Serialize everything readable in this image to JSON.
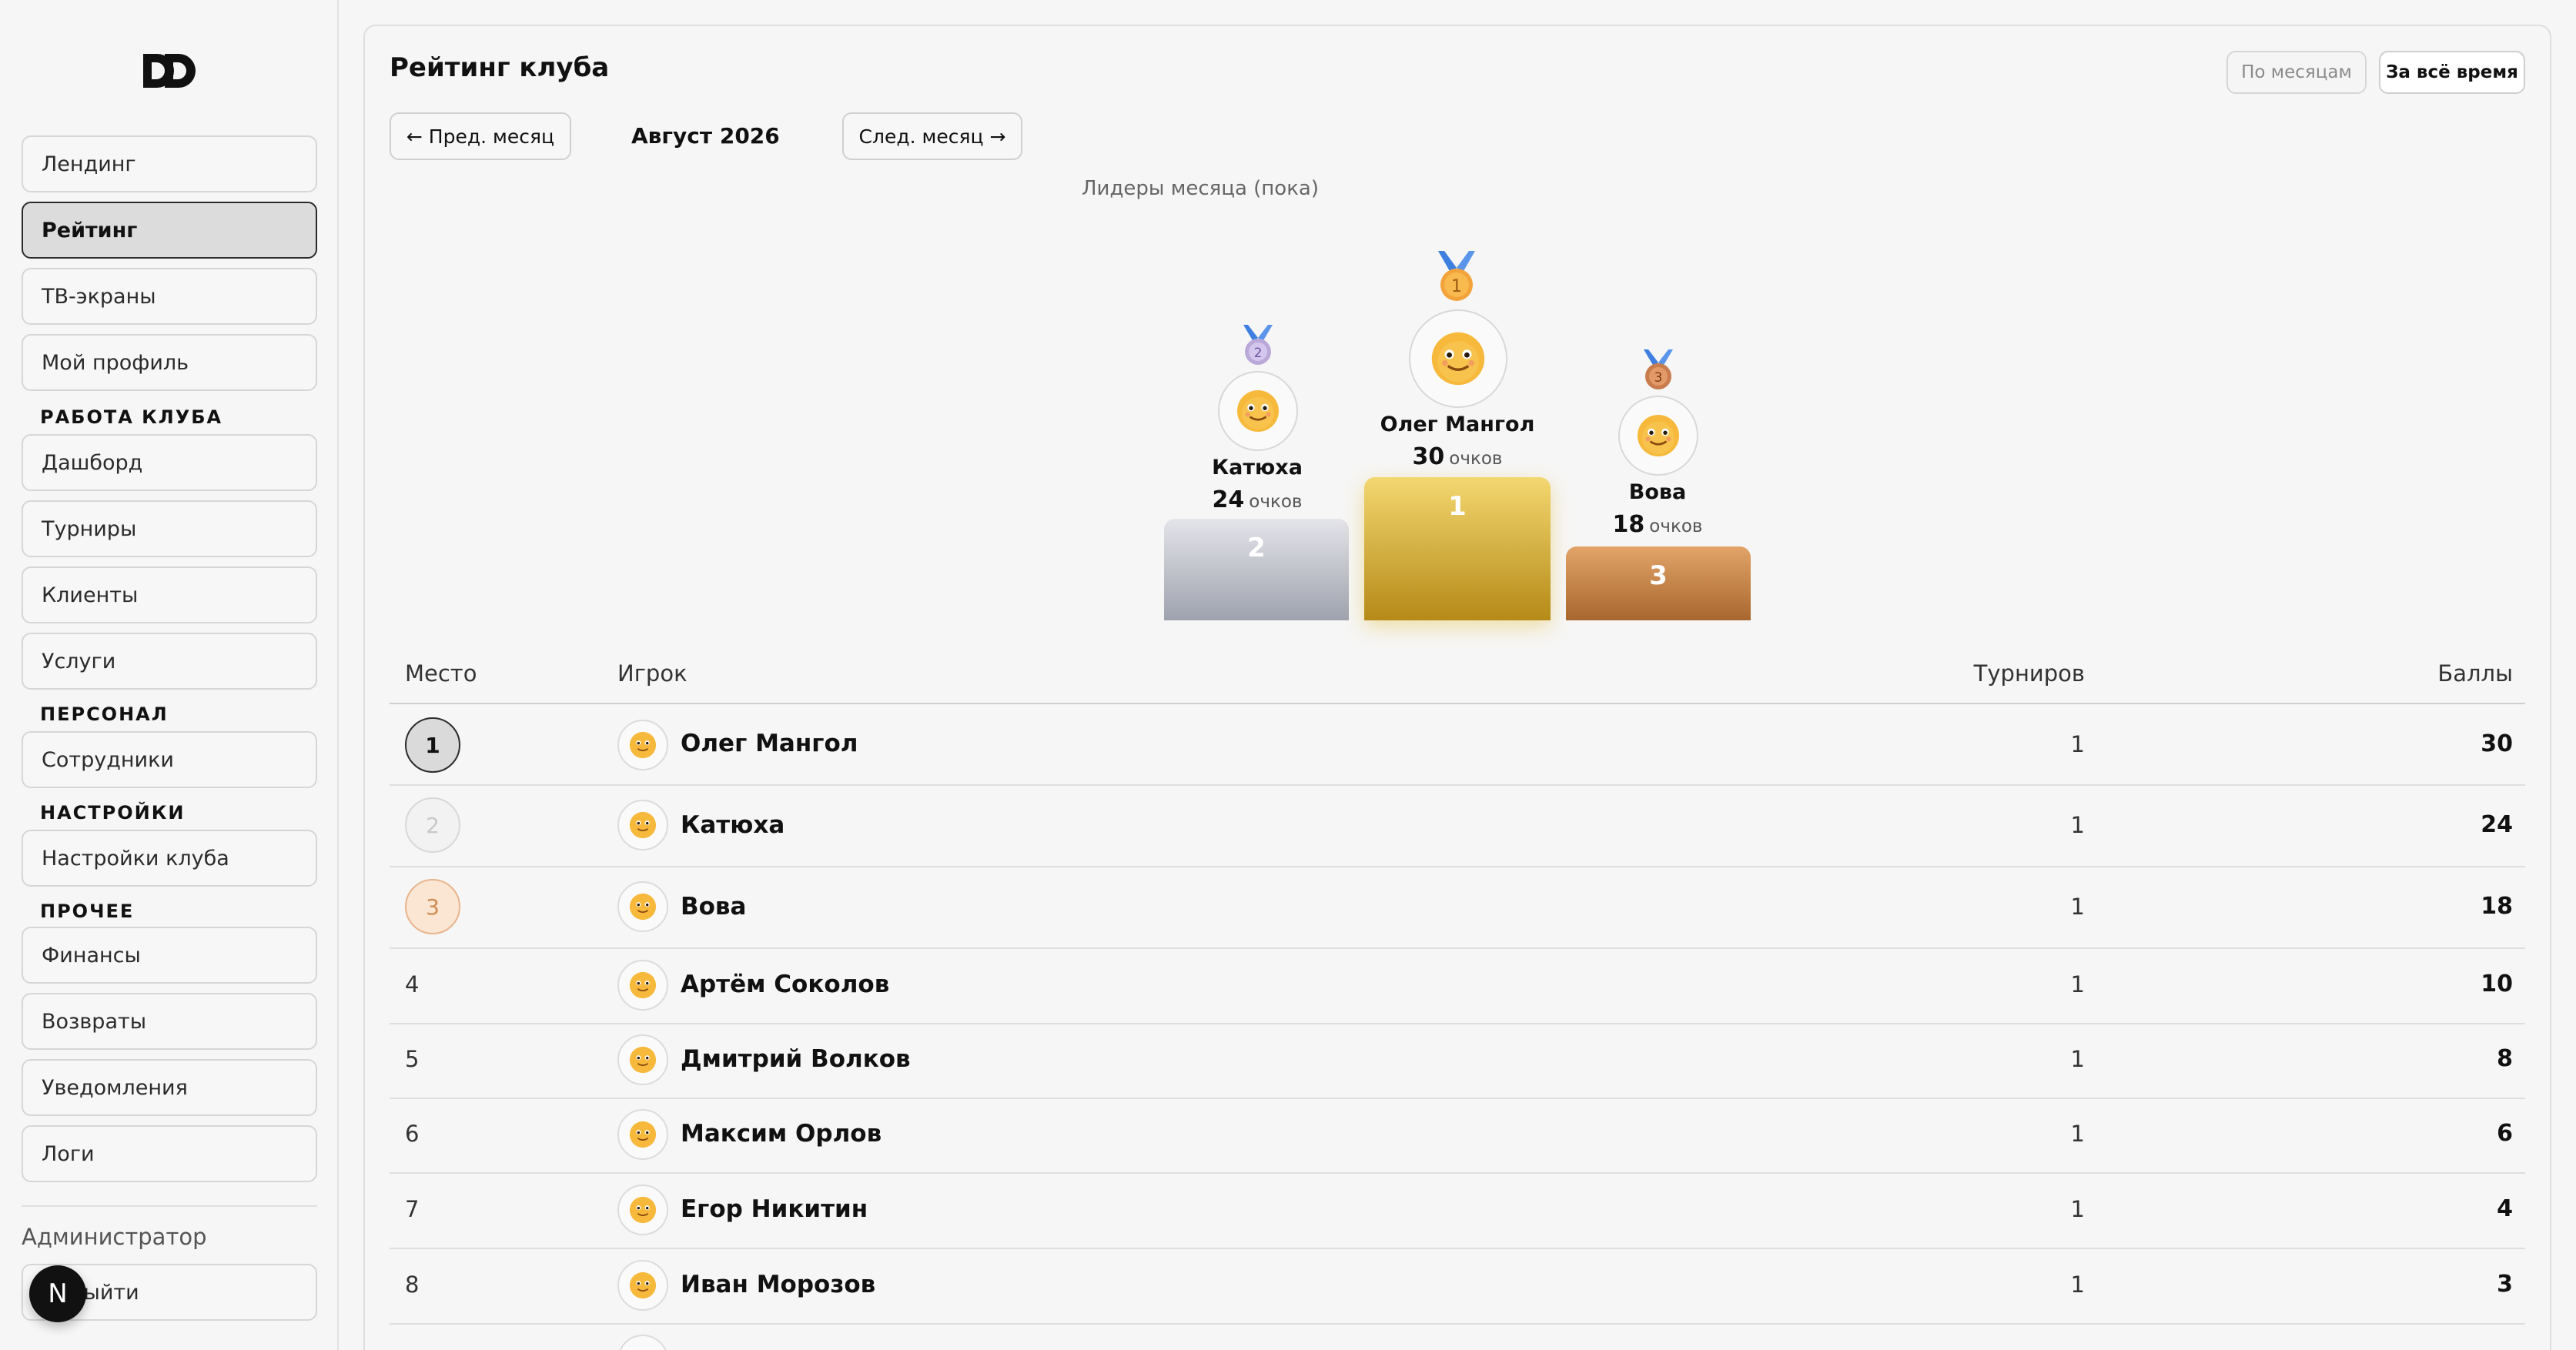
{
  "sidebar": {
    "logo": "DD",
    "items": [
      {
        "label": "Лендинг"
      },
      {
        "label": "Рейтинг",
        "active": true
      },
      {
        "label": "ТВ-экраны"
      },
      {
        "label": "Мой профиль"
      },
      {
        "label": "Дашборд"
      },
      {
        "label": "Турниры"
      },
      {
        "label": "Клиенты"
      },
      {
        "label": "Услуги"
      },
      {
        "label": "Сотрудники"
      },
      {
        "label": "Настройки клуба"
      },
      {
        "label": "Финансы"
      },
      {
        "label": "Возвраты"
      },
      {
        "label": "Уведомления"
      },
      {
        "label": "Логи"
      }
    ],
    "sections": {
      "club_work": "РАБОТА КЛУБА",
      "staff": "ПЕРСОНАЛ",
      "settings": "НАСТРОЙКИ",
      "other": "ПРОЧЕЕ"
    },
    "role": "Администратор",
    "logout_label": "Выйти",
    "avatar_letter": "N"
  },
  "main": {
    "title": "Рейтинг клуба",
    "toggle": {
      "by_month": "По месяцам",
      "all_time": "За всё время"
    },
    "prev_month": "← Пред. месяц",
    "next_month": "След. месяц →",
    "month": "Август 2026",
    "leaders_title": "Лидеры месяца (пока)",
    "points_word": "очков",
    "podium": {
      "first": {
        "name": "Олег Мангол",
        "score": "30",
        "place": "1"
      },
      "second": {
        "name": "Катюха",
        "score": "24",
        "place": "2"
      },
      "third": {
        "name": "Вова",
        "score": "18",
        "place": "3"
      }
    },
    "table": {
      "headers": {
        "place": "Место",
        "player": "Игрок",
        "tournaments": "Турниров",
        "points": "Баллы"
      },
      "rows": [
        {
          "place": "1",
          "name": "Олег Мангол",
          "tournaments": "1",
          "points": "30"
        },
        {
          "place": "2",
          "name": "Катюха",
          "tournaments": "1",
          "points": "24"
        },
        {
          "place": "3",
          "name": "Вова",
          "tournaments": "1",
          "points": "18"
        },
        {
          "place": "4",
          "name": "Артём Соколов",
          "tournaments": "1",
          "points": "10"
        },
        {
          "place": "5",
          "name": "Дмитрий Волков",
          "tournaments": "1",
          "points": "8"
        },
        {
          "place": "6",
          "name": "Максим Орлов",
          "tournaments": "1",
          "points": "6"
        },
        {
          "place": "7",
          "name": "Егор Никитин",
          "tournaments": "1",
          "points": "4"
        },
        {
          "place": "8",
          "name": "Иван Морозов",
          "tournaments": "1",
          "points": "3"
        }
      ]
    }
  }
}
